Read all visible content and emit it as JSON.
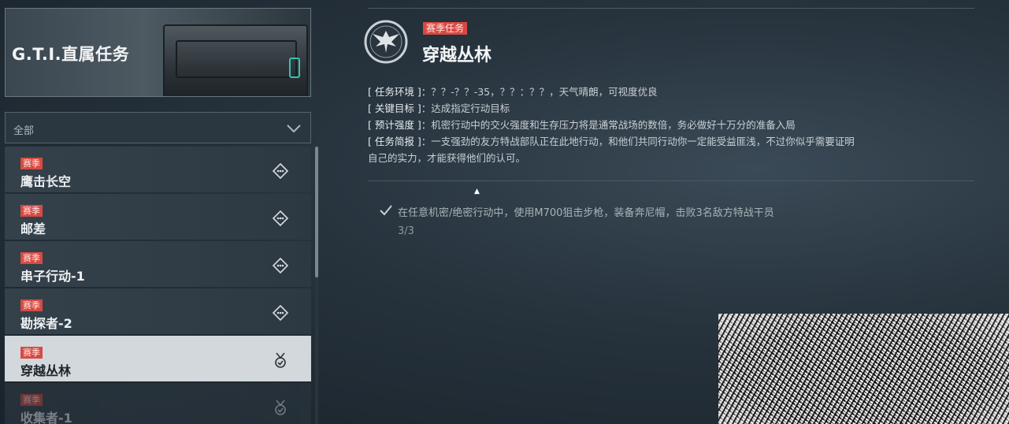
{
  "banner": {
    "title": "G.T.I.直属任务"
  },
  "filter": {
    "label": "全部"
  },
  "missions": [
    {
      "badge": "赛季",
      "name": "鹰击长空",
      "icon": "diamond-dots-icon"
    },
    {
      "badge": "赛季",
      "name": "邮差",
      "icon": "diamond-dots-icon"
    },
    {
      "badge": "赛季",
      "name": "串子行动-1",
      "icon": "diamond-dots-icon"
    },
    {
      "badge": "赛季",
      "name": "勘探者-2",
      "icon": "diamond-dots-icon"
    },
    {
      "badge": "赛季",
      "name": "穿越丛林",
      "icon": "medal-check-icon"
    },
    {
      "badge": "赛季",
      "name": "收集者-1",
      "icon": "medal-check-icon"
    }
  ],
  "selected_index": 4,
  "detail": {
    "tag": "赛季任务",
    "title": "穿越丛林",
    "info": [
      {
        "key": "[ 任务环境 ]",
        "value": "：？？-？？-35，？？：？？，天气晴朗，可视度优良"
      },
      {
        "key": "[ 关键目标 ]",
        "value": "：达成指定行动目标"
      },
      {
        "key": "[ 预计强度 ]",
        "value": "：机密行动中的交火强度和生存压力将是通常战场的数倍，务必做好十万分的准备入局"
      },
      {
        "key": "[ 任务简报 ]",
        "value": "：一支强劲的友方特战部队正在此地行动，和他们共同行动你一定能受益匪浅，不过你似乎需要证明自己的实力，才能获得他们的认可。"
      }
    ],
    "objective": {
      "pre": "在任意机密/绝密行动中，使用",
      "weapon": "M700狙击步枪",
      "mid": "，装备",
      "gear": "奔尼帽",
      "post": "，击败3名敌方特战干员",
      "progress": "3/3"
    }
  }
}
